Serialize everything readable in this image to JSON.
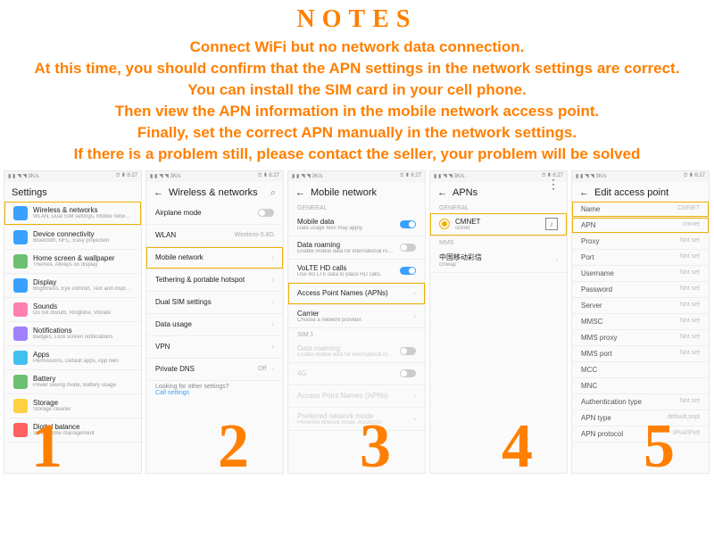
{
  "header": {
    "title": "NOTES",
    "lines": [
      "Connect WiFi but no network data connection.",
      "At this time, you should confirm that the APN settings in the network settings are correct.",
      "You can install the SIM card in your cell phone.",
      "Then view the APN information in the mobile network access point.",
      "Finally, set the correct APN manually in the network settings.",
      "If there is a problem still, please contact the seller, your problem will be solved"
    ]
  },
  "status": {
    "left": "▮ ▮ ◥ ◥  3K/s",
    "right_signals": "⏱ ▮ 6:27"
  },
  "screens": {
    "s1": {
      "title": "Settings",
      "num": "1",
      "items": [
        {
          "t": "Wireless & networks",
          "s": "WLAN, Dual SIM settings, Mobile network",
          "ico": "blue",
          "hl": true
        },
        {
          "t": "Device connectivity",
          "s": "Bluetooth, NFC, Easy projection",
          "ico": "blue"
        },
        {
          "t": "Home screen & wallpaper",
          "s": "Themes, Always on display",
          "ico": "green"
        },
        {
          "t": "Display",
          "s": "Brightness, Eye comfort, Text and display size",
          "ico": "blue"
        },
        {
          "t": "Sounds",
          "s": "Do not disturb, Ringtone, Vibrate",
          "ico": "pink"
        },
        {
          "t": "Notifications",
          "s": "Badges, Lock screen notifications",
          "ico": "purple"
        },
        {
          "t": "Apps",
          "s": "Permissions, Default apps, App twin",
          "ico": "blue2"
        },
        {
          "t": "Battery",
          "s": "Power saving mode, Battery usage",
          "ico": "green"
        },
        {
          "t": "Storage",
          "s": "Storage cleaner",
          "ico": "yellow"
        },
        {
          "t": "Digital balance",
          "s": "Screen time management",
          "ico": "red"
        }
      ]
    },
    "s2": {
      "title": "Wireless & networks",
      "num": "2",
      "items": [
        {
          "t": "Airplane mode",
          "toggle": "off"
        },
        {
          "t": "WLAN",
          "side": "Wireless-5.8G"
        },
        {
          "t": "Mobile network",
          "hl": true,
          "chev": true
        },
        {
          "t": "Tethering & portable hotspot",
          "chev": true
        },
        {
          "t": "Dual SIM settings",
          "chev": true
        },
        {
          "t": "Data usage",
          "chev": true
        },
        {
          "t": "VPN",
          "chev": true
        },
        {
          "t": "Private DNS",
          "side": "Off",
          "chev": true
        }
      ],
      "footer_tip": "Looking for other settings?",
      "footer_link": "Call settings"
    },
    "s3": {
      "title": "Mobile network",
      "num": "3",
      "general": "GENERAL",
      "sim1": "SIM 1",
      "items_g": [
        {
          "t": "Mobile data",
          "s": "Data usage fees may apply.",
          "toggle": "on"
        },
        {
          "t": "Data roaming",
          "s": "Enable mobile data for international roaming.",
          "toggle": "off"
        },
        {
          "t": "VoLTE HD calls",
          "s": "Use 4G LTE data to place HD calls.",
          "toggle": "on"
        },
        {
          "t": "Access Point Names (APNs)",
          "hl": true,
          "chev": true
        },
        {
          "t": "Carrier",
          "s": "Choose a network provider.",
          "chev": true
        }
      ],
      "items_s": [
        {
          "t": "Data roaming",
          "s": "Enable mobile data for international roaming.",
          "toggle": "off",
          "dim": true
        },
        {
          "t": "4G",
          "toggle": "off",
          "dim": true
        },
        {
          "t": "Access Point Names (APNs)",
          "chev": true,
          "dim": true
        },
        {
          "t": "Preferred network mode",
          "s": "Preferred network mode: 4G/3G/2G",
          "chev": true,
          "dim": true
        }
      ]
    },
    "s4": {
      "title": "APNs",
      "num": "4",
      "general": "GENERAL",
      "mms": "MMS",
      "apn_g": {
        "t": "CMNET",
        "s": "cmnet",
        "hl": true
      },
      "apn_m": {
        "t": "中国移动彩信",
        "s": "cmwap"
      }
    },
    "s5": {
      "title": "Edit access point",
      "num": "5",
      "hl_name": "Name",
      "hl_name_v": "CMNET",
      "hl_apn": "APN",
      "hl_apn_v": "cmnet",
      "rows": [
        [
          "Proxy",
          "Not set"
        ],
        [
          "Port",
          "Not set"
        ],
        [
          "Username",
          "Not set"
        ],
        [
          "Password",
          "Not set"
        ],
        [
          "Server",
          "Not set"
        ],
        [
          "MMSC",
          "Not set"
        ],
        [
          "MMS proxy",
          "Not set"
        ],
        [
          "MMS port",
          "Not set"
        ],
        [
          "MCC",
          ""
        ],
        [
          "MNC",
          ""
        ],
        [
          "Authentication type",
          "Not set"
        ],
        [
          "APN type",
          "default,supl"
        ],
        [
          "APN protocol",
          "IPv4/IPv6"
        ]
      ]
    }
  }
}
